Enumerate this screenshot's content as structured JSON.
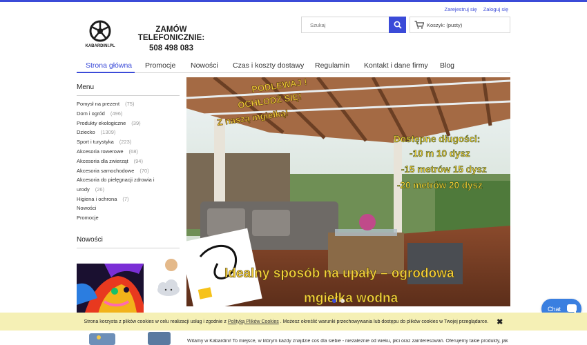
{
  "header": {
    "account_links": [
      "Zarejestruj się",
      "Zaloguj się"
    ],
    "logo_text": "KABARDINI.PL",
    "phone_label": "ZAMÓW TELEFONICZNIE:",
    "phone_number": "508 498 083",
    "search_placeholder": "Szukaj",
    "cart_label": "Koszyk: (pusty)"
  },
  "nav": [
    {
      "label": "Strona główna",
      "active": true
    },
    {
      "label": "Promocje"
    },
    {
      "label": "Nowości"
    },
    {
      "label": "Czas i koszty dostawy"
    },
    {
      "label": "Regulamin"
    },
    {
      "label": "Kontakt i dane firmy"
    },
    {
      "label": "Blog"
    }
  ],
  "sidebar": {
    "menu_title": "Menu",
    "items": [
      {
        "label": "Pomysł na prezent",
        "count": "(75)"
      },
      {
        "label": "Dom i ogród",
        "count": "(496)"
      },
      {
        "label": "Produkty ekologiczne",
        "count": "(39)"
      },
      {
        "label": "Dziecko",
        "count": "(1309)"
      },
      {
        "label": "Sport i turystyka",
        "count": "(223)"
      },
      {
        "label": "Akcesoria rowerowe",
        "count": "(68)"
      },
      {
        "label": "Akcesoria dla zwierząt",
        "count": "(94)"
      },
      {
        "label": "Akcesoria samochodowe",
        "count": "(70)"
      },
      {
        "label": "Akcesoria do pielęgnacji zdrowia i",
        "count": ""
      },
      {
        "label": "urody",
        "count": "(26)"
      },
      {
        "label": "Higiena i ochrona",
        "count": "(7)"
      },
      {
        "label": "Nowości",
        "count": ""
      },
      {
        "label": "Promocje",
        "count": ""
      }
    ],
    "news_title": "Nowości"
  },
  "slider": {
    "promo_line1": "PODLEWAJ !",
    "promo_line2": "OCHŁODŹ SIĘ!",
    "promo_line3": "Z naszą mgiełką!",
    "lengths_title": "Dostępne długości:",
    "lengths": [
      "-10 m 10 dysz",
      "-15 metrów 15 dysz",
      "-20 metrów 20 dysz"
    ],
    "caption_line1": "Idealny sposób na upały – ogrodowa",
    "caption_line2": "mgiełka wodna"
  },
  "chat": {
    "label": "Chat"
  },
  "cookie": {
    "text_before": "Strona korzysta z plików cookies w celu realizacji usług i zgodnie z",
    "link": "Polityką Plików Cookies",
    "text_after": ". Możesz określić warunki przechowywania lub dostępu do plików cookies w Twojej przeglądarce."
  },
  "welcome_text": "Witamy w Kabardini! To miejsce, w którym każdy znajdzie coś dla siebie - niezależnie od wieku, płci oraz zainteresowań. Oferujemy takie produkty, jak",
  "colors": {
    "accent": "#3b4bd8",
    "cookie_bg": "#f5f0b5",
    "chat": "#3a7fe0",
    "promo_yellow": "#f6d23a"
  }
}
